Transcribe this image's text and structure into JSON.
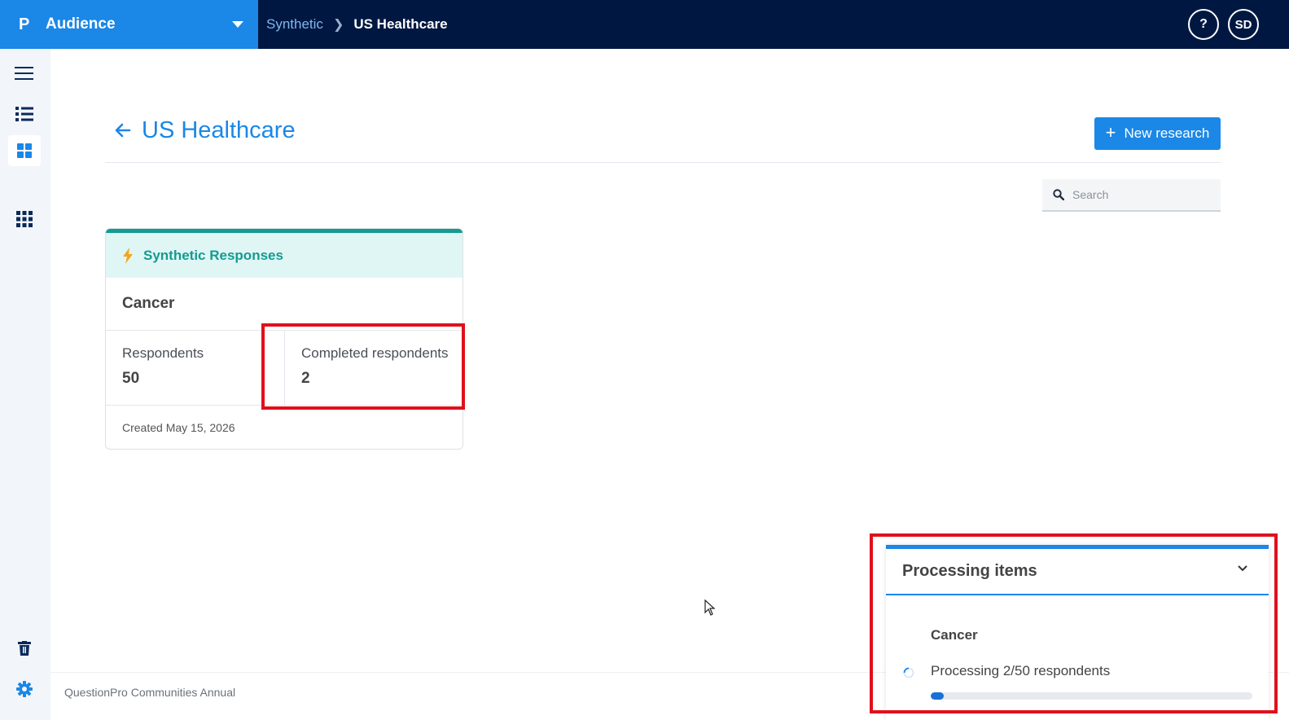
{
  "app": {
    "name": "Audience",
    "logo_glyph": "P",
    "brand_color": "#1b87e6",
    "topbar_color": "#001841"
  },
  "breadcrumb": {
    "parent": "Synthetic",
    "current": "US Healthcare"
  },
  "topbar": {
    "help_label": "?",
    "avatar_initials": "SD"
  },
  "sidebar": {
    "items": [
      {
        "icon": "hamburger-menu-icon"
      },
      {
        "icon": "list-icon"
      },
      {
        "icon": "dashboard-grid-icon",
        "active": true
      },
      {
        "icon": "apps-grid-icon"
      },
      {
        "icon": "trash-icon"
      },
      {
        "icon": "settings-gear-icon"
      }
    ]
  },
  "page": {
    "title": "US Healthcare",
    "new_button_label": "New research",
    "search_placeholder": "Search"
  },
  "card": {
    "type_label": "Synthetic Responses",
    "title": "Cancer",
    "respondents_label": "Respondents",
    "respondents_value": "50",
    "completed_label": "Completed respondents",
    "completed_value": "2",
    "created": "Created May 15, 2026",
    "accent_color": "#159b90"
  },
  "footer": {
    "text": "QuestionPro Communities Annual"
  },
  "processing": {
    "title": "Processing items",
    "item_name": "Cancer",
    "status": "Processing 2/50 respondents",
    "progress_fraction": 0.04
  }
}
